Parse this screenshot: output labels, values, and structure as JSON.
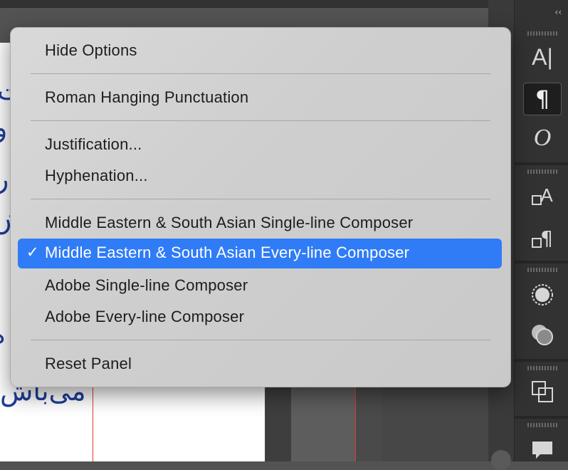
{
  "menu": {
    "items": [
      {
        "label": "Hide Options"
      },
      {
        "label": "Roman Hanging Punctuation"
      },
      {
        "label": "Justification..."
      },
      {
        "label": "Hyphenation..."
      },
      {
        "label": "Middle Eastern & South Asian Single-line Composer"
      },
      {
        "label": "Middle Eastern & South Asian Every-line Composer",
        "checked": true
      },
      {
        "label": "Adobe Single-line Composer"
      },
      {
        "label": "Adobe Every-line Composer"
      },
      {
        "label": "Reset Panel"
      }
    ],
    "check_glyph": "✓"
  },
  "document": {
    "text_fragments": [
      "ت",
      "و",
      "ر",
      "ش",
      "ه",
      "می‌باش"
    ]
  },
  "panel": {
    "collapse_glyph": "‹‹",
    "tools": [
      {
        "name": "character-icon",
        "glyph": "A|"
      },
      {
        "name": "paragraph-icon",
        "glyph": "¶",
        "active": true
      },
      {
        "name": "opentype-icon",
        "glyph": "O"
      },
      {
        "name": "character-styles-icon",
        "glyph": "A"
      },
      {
        "name": "paragraph-styles-icon",
        "glyph": "¶"
      },
      {
        "name": "appearance-icon",
        "glyph": "◌"
      },
      {
        "name": "transparency-icon",
        "glyph": "◐"
      },
      {
        "name": "pathfinder-icon",
        "glyph": "⧉"
      },
      {
        "name": "comments-icon",
        "glyph": "▭"
      }
    ]
  },
  "colors": {
    "selection": "#2f7cf6",
    "guide": "#e0392f",
    "text_blue": "#1f3e9a"
  }
}
